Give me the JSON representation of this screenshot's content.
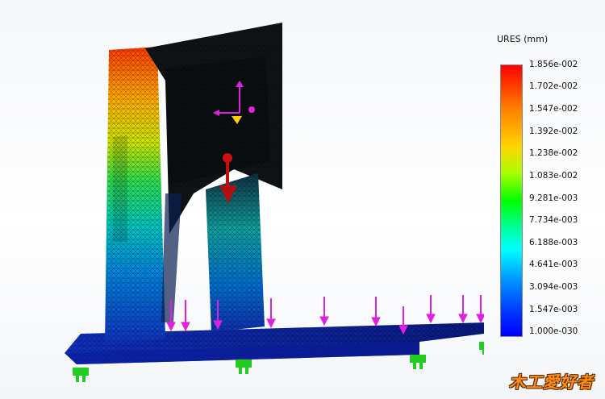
{
  "legend": {
    "title": "URES (mm)",
    "ticks": [
      "1.856e-002",
      "1.702e-002",
      "1.547e-002",
      "1.392e-002",
      "1.238e-002",
      "1.083e-002",
      "9.281e-003",
      "7.734e-003",
      "6.188e-003",
      "4.641e-003",
      "3.094e-003",
      "1.547e-003",
      "1.000e-030"
    ]
  },
  "watermark": {
    "text": "木工愛好者"
  },
  "icons": {
    "load_arrow": "red-load-arrow-icon",
    "fixture": "green-fixture-icon",
    "force": "magenta-force-arrow-icon",
    "triad": "coordinate-triad-icon"
  },
  "colors": {
    "max": "#ff0000",
    "min": "#0000ff",
    "force": "#e020e0",
    "fixture": "#22cc22",
    "load": "#cc1010"
  }
}
